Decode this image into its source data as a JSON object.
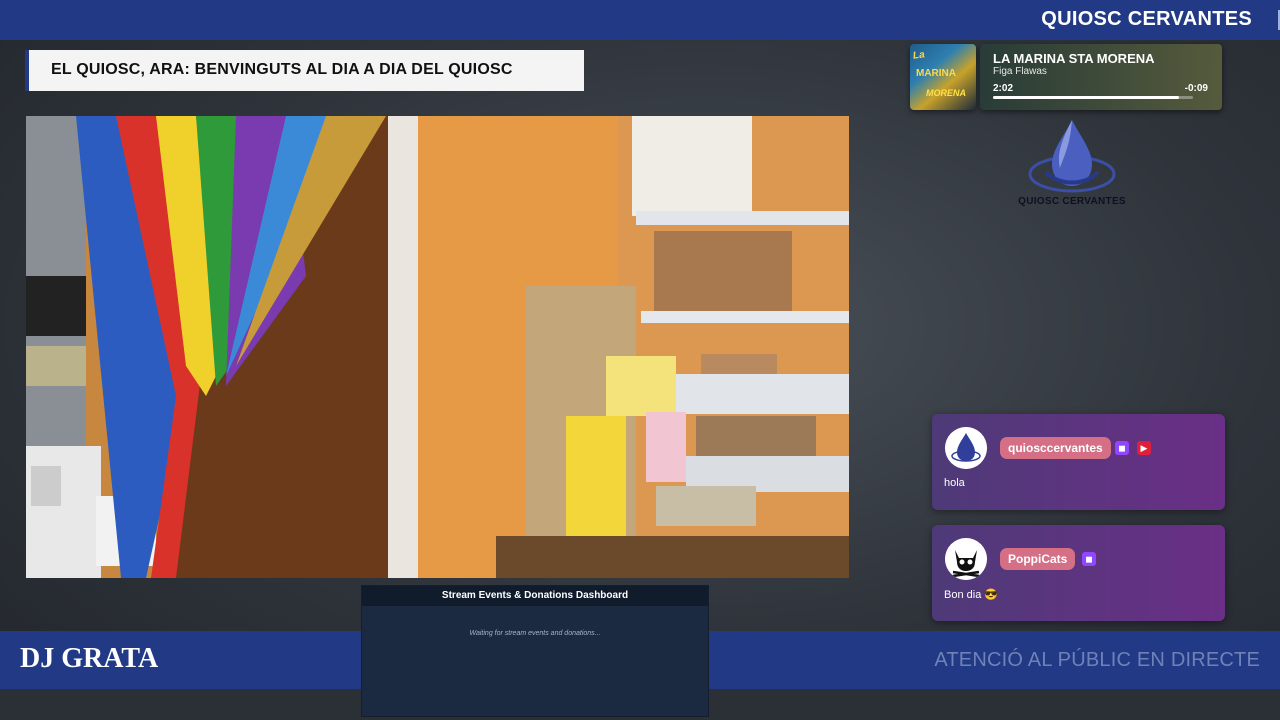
{
  "top_bar": {
    "brand": "QUIOSC CERVANTES"
  },
  "headline": {
    "text": "EL QUIOSC, ARA: BENVINGUTS AL DIA A DIA DEL QUIOSC"
  },
  "now_playing": {
    "title": "LA MARINA STA MORENA",
    "artist": "Figa Flawas",
    "elapsed": "2:02",
    "remaining": "-0:09",
    "progress_fraction": 0.93,
    "cover_art_lettering": [
      "La",
      "MARINA",
      "MORENA"
    ]
  },
  "logo": {
    "text": "QUIOSC CERVANTES"
  },
  "chat": [
    {
      "user": "quiosccervantes",
      "message": "hola",
      "badges": [
        "twitch-icon",
        "camera-icon"
      ]
    },
    {
      "user": "PoppiCats",
      "message": "Bon dia 😎",
      "badges": [
        "twitch-icon"
      ]
    }
  ],
  "dashboard": {
    "title": "Stream Events & Donations Dashboard",
    "status": "Waiting for stream events and donations..."
  },
  "bottom_bar": {
    "left": "DJ GRATA",
    "right": "ATENCIÓ AL PÚBLIC EN DIRECTE"
  },
  "colors": {
    "brand_blue": "#223a86",
    "chat_name_pill": "#d46f86",
    "chat_card": "#5e3486",
    "twitch_badge": "#9146ff",
    "camera_badge": "#e0203a"
  }
}
